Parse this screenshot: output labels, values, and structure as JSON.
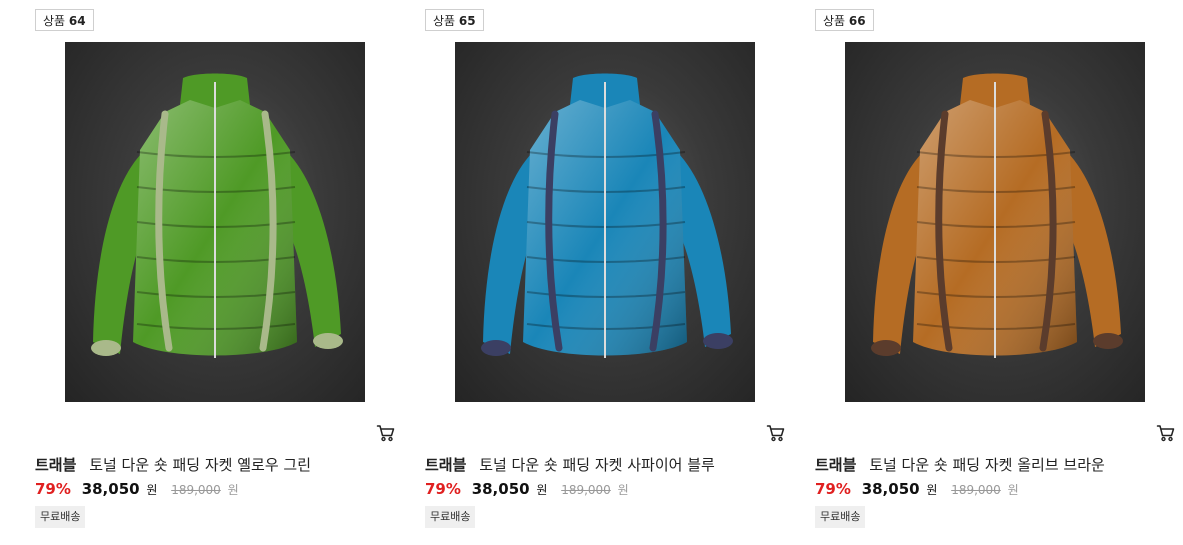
{
  "products": [
    {
      "rank_label": "상품",
      "rank_number": "64",
      "brand": "트래블",
      "name": "토널 다운 숏 패딩 자켓 옐로우 그린",
      "discount": "79%",
      "sale_price": "38,050",
      "sale_currency": "원",
      "original_price": "189,000",
      "original_currency": "원",
      "shipping_tag": "무료배송",
      "jacket_color": "#4f9a26",
      "jacket_trim": "#a9b98a",
      "cart_icon": "shopping-cart-icon"
    },
    {
      "rank_label": "상품",
      "rank_number": "65",
      "brand": "트래블",
      "name": "토널 다운 숏 패딩 자켓 사파이어 블루",
      "discount": "79%",
      "sale_price": "38,050",
      "sale_currency": "원",
      "original_price": "189,000",
      "original_currency": "원",
      "shipping_tag": "무료배송",
      "jacket_color": "#1a86b8",
      "jacket_trim": "#3b3f63",
      "cart_icon": "shopping-cart-icon"
    },
    {
      "rank_label": "상품",
      "rank_number": "66",
      "brand": "트래블",
      "name": "토널 다운 숏 패딩 자켓 올리브 브라운",
      "discount": "79%",
      "sale_price": "38,050",
      "sale_currency": "원",
      "original_price": "189,000",
      "original_currency": "원",
      "shipping_tag": "무료배송",
      "jacket_color": "#b56c24",
      "jacket_trim": "#5b3c2c",
      "cart_icon": "shopping-cart-icon"
    }
  ],
  "colors": {
    "discount": "#e02020",
    "original_price": "#999999",
    "ship_tag_bg": "#efefef"
  }
}
